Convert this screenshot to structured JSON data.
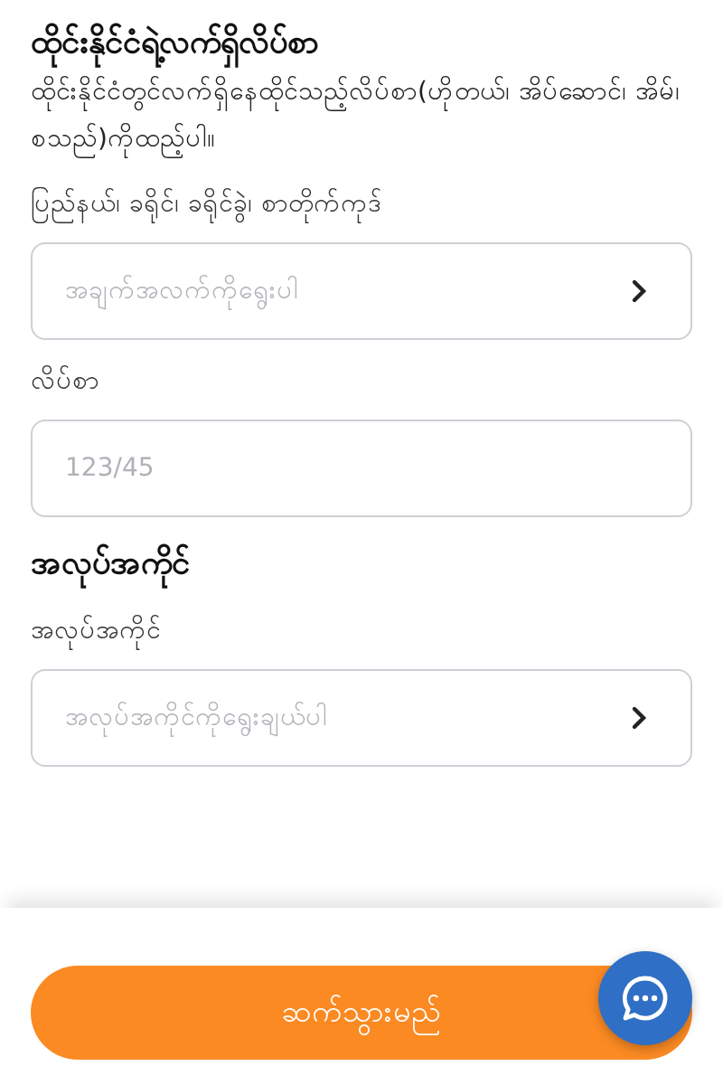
{
  "sections": [
    {
      "title": "ထိုင်းနိုင်ငံရဲ့လက်ရှိလိပ်စာ",
      "description": "ထိုင်းနိုင်ငံတွင်လက်ရှိနေထိုင်သည့်လိပ်စာ(ဟိုတယ်၊ အိပ်ဆောင်၊ အိမ်၊ စသည်)ကိုထည့်ပါ။",
      "fields": [
        {
          "kind": "select",
          "label": "ပြည်နယ်၊ ခရိုင်၊ ခရိုင်ခွဲ၊ စာတိုက်ကုဒ်",
          "placeholder": "အချက်အလက်ကိုရွေးပါ"
        },
        {
          "kind": "text",
          "label": "လိပ်စာ",
          "placeholder": "123/45"
        }
      ]
    },
    {
      "title": "အလုပ်အကိုင်",
      "fields": [
        {
          "kind": "select",
          "label": "အလုပ်အကိုင်",
          "placeholder": "အလုပ်အကိုင်ကိုရွေးချယ်ပါ"
        }
      ]
    }
  ],
  "continue_button": "ဆက်သွားမည်"
}
